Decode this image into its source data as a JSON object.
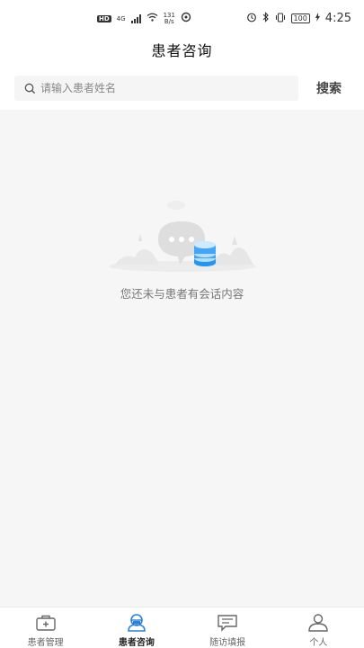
{
  "status_bar": {
    "left_badge": "HD",
    "network_type": "4G",
    "net_speed_value": "131",
    "net_speed_unit": "B/s",
    "battery": "100",
    "time": "4:25"
  },
  "header": {
    "title": "患者咨询"
  },
  "search": {
    "placeholder": "请输入患者姓名",
    "value": "",
    "button_label": "搜索"
  },
  "empty_state": {
    "message": "您还未与患者有会话内容"
  },
  "tab_bar": {
    "active_index": 1,
    "items": [
      {
        "label": "患者管理",
        "icon": "medical-kit-icon"
      },
      {
        "label": "患者咨询",
        "icon": "doctor-chat-icon"
      },
      {
        "label": "随访填报",
        "icon": "message-form-icon"
      },
      {
        "label": "个人",
        "icon": "person-icon"
      }
    ]
  },
  "colors": {
    "accent": "#2196f3",
    "background": "#f6f6f6",
    "active_tab_icon": "#2a7fd8"
  }
}
